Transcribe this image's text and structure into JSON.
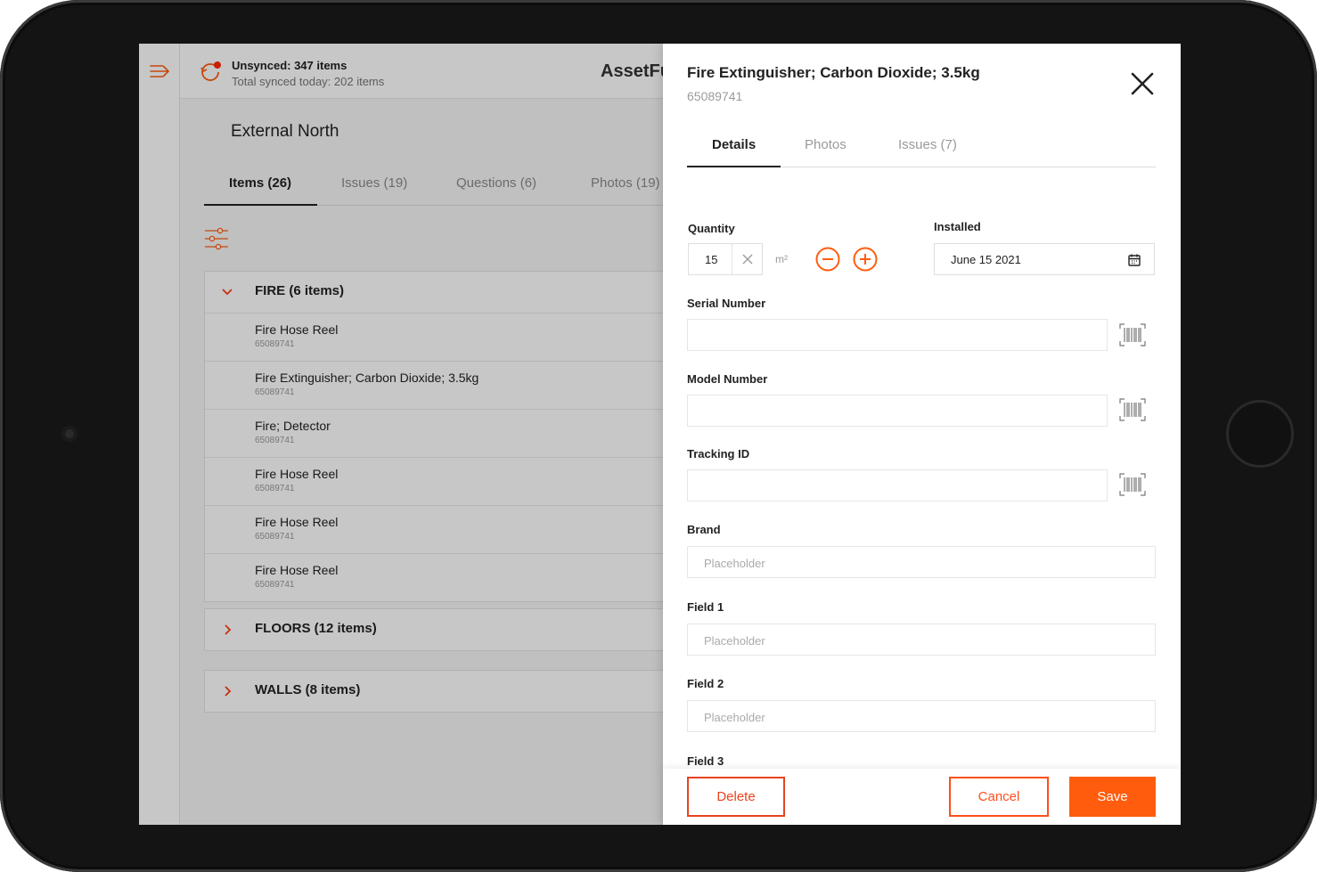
{
  "sync": {
    "title": "Unsynced: 347 items",
    "subtitle": "Total synced today: 202 items"
  },
  "app": {
    "brand": "AssetFu"
  },
  "location": {
    "title": "External North",
    "tabs": [
      {
        "label": "Items (26)"
      },
      {
        "label": "Issues (19)"
      },
      {
        "label": "Questions (6)"
      },
      {
        "label": "Photos (19)"
      }
    ]
  },
  "groups": [
    {
      "title": "FIRE (6 items)",
      "items": [
        {
          "name": "Fire Hose Reel",
          "code": "65089741"
        },
        {
          "name": "Fire Extinguisher; Carbon Dioxide; 3.5kg",
          "code": "65089741"
        },
        {
          "name": "Fire; Detector",
          "code": "65089741"
        },
        {
          "name": "Fire Hose Reel",
          "code": "65089741"
        },
        {
          "name": "Fire Hose Reel",
          "code": "65089741"
        },
        {
          "name": "Fire Hose Reel",
          "code": "65089741"
        }
      ]
    },
    {
      "title": "FLOORS (12 items)"
    },
    {
      "title": "WALLS (8 items)"
    }
  ],
  "panel": {
    "title": "Fire Extinguisher; Carbon Dioxide; 3.5kg",
    "code": "65089741",
    "tabs": [
      {
        "label": "Details"
      },
      {
        "label": "Photos"
      },
      {
        "label": "Issues (7)"
      }
    ],
    "quantity": {
      "label": "Quantity",
      "value": "15",
      "unit": "m²"
    },
    "installed": {
      "label": "Installed",
      "value": "June 15 2021"
    },
    "serial": {
      "label": "Serial Number",
      "value": ""
    },
    "model": {
      "label": "Model Number",
      "value": ""
    },
    "tracking": {
      "label": "Tracking ID",
      "value": ""
    },
    "brand": {
      "label": "Brand",
      "placeholder": "Placeholder"
    },
    "field1": {
      "label": "Field 1",
      "placeholder": "Placeholder"
    },
    "field2": {
      "label": "Field 2",
      "placeholder": "Placeholder"
    },
    "field3": {
      "label": "Field 3"
    }
  },
  "footer": {
    "delete_label": "Delete",
    "cancel_label": "Cancel",
    "save_label": "Save"
  },
  "colors": {
    "accent": "#ff5c0e",
    "accent_outline": "#ff4f1a"
  }
}
